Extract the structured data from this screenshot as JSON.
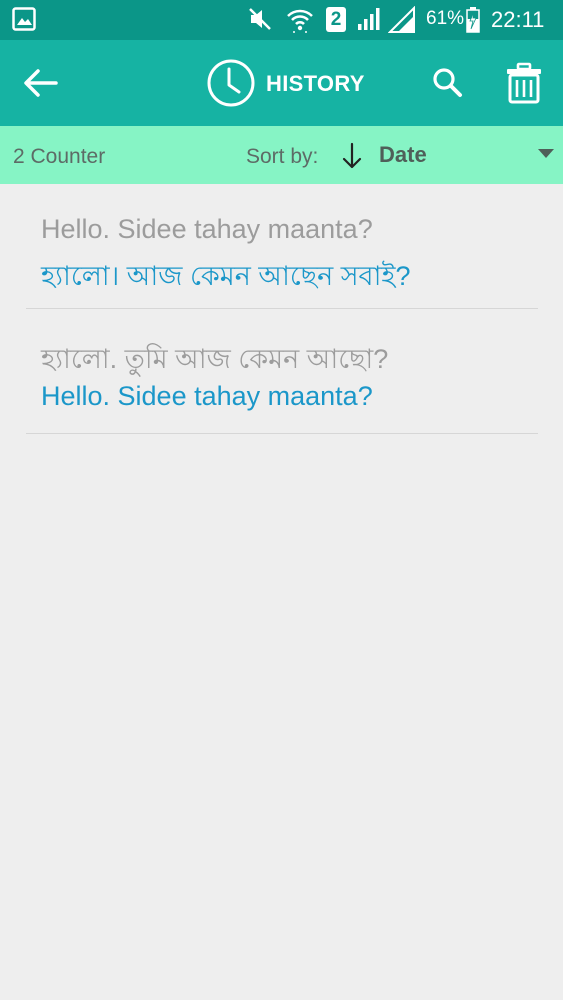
{
  "status_bar": {
    "sim_slot": "2",
    "battery_percent": "61%",
    "time": "22:11",
    "icons": [
      "gallery-icon",
      "mute-icon",
      "wifi-icon",
      "signal-icon",
      "battery-charging-icon"
    ]
  },
  "app_bar": {
    "title": "HISTORY",
    "icons": [
      "back-arrow-icon",
      "clock-icon",
      "search-icon",
      "trash-icon"
    ]
  },
  "sort_bar": {
    "counter": "2 Counter",
    "sort_by_label": "Sort by:",
    "sort_value": "Date",
    "sort_direction": "descending"
  },
  "history": [
    {
      "source": "Hello. Sidee tahay maanta?",
      "translation": "হ্যালো। আজ কেমন আছেন সবাই?"
    },
    {
      "source": "হ্যালো. তুমি আজ কেমন আছো?",
      "translation": "Hello. Sidee tahay maanta?"
    }
  ],
  "colors": {
    "status_bar": "#0b9688",
    "app_bar": "#16b3a3",
    "sort_bar": "#86f4c5",
    "background": "#eeeeee",
    "source_text": "#9c9c9c",
    "translation_text": "#1b97c9"
  }
}
